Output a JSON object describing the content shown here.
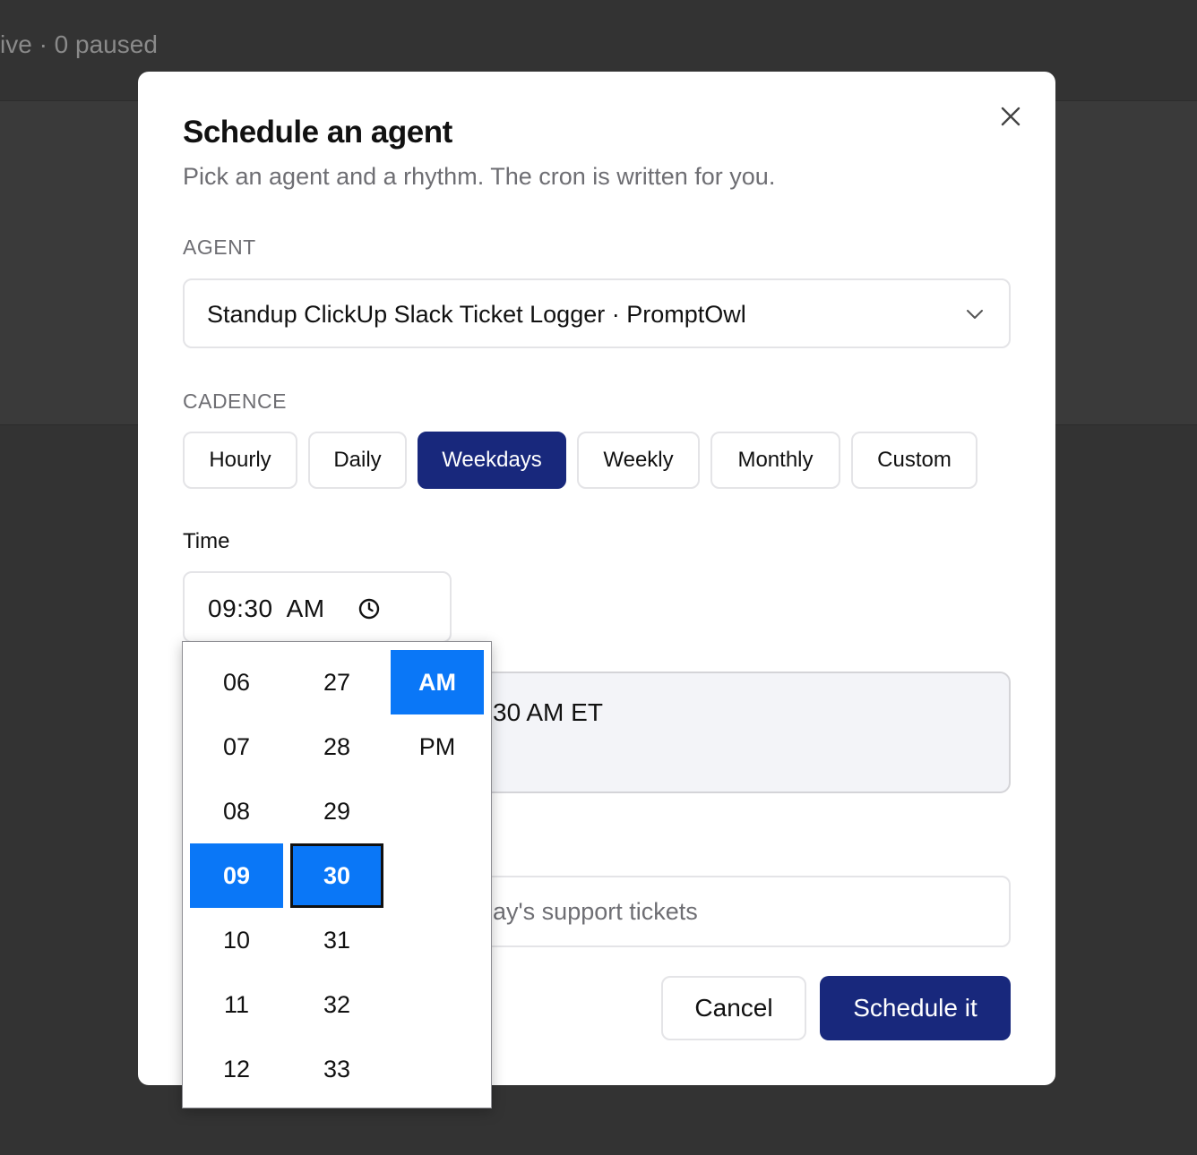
{
  "background": {
    "status_text": "ive · 0 paused"
  },
  "modal": {
    "title": "Schedule an agent",
    "subtitle": "Pick an agent and a rhythm. The cron is written for you.",
    "close_icon": "close-icon",
    "agent": {
      "label": "AGENT",
      "selected": "Standup ClickUp Slack Ticket Logger · PromptOwl",
      "chevron_icon": "chevron-down-icon"
    },
    "cadence": {
      "label": "CADENCE",
      "options": [
        "Hourly",
        "Daily",
        "Weekdays",
        "Weekly",
        "Monthly",
        "Custom"
      ],
      "selected": "Weekdays"
    },
    "time": {
      "label": "Time",
      "value": "09:30  AM",
      "icon": "clock-icon"
    },
    "summary_text": "30 AM ET",
    "name_placeholder": "ay's support tickets",
    "buttons": {
      "cancel": "Cancel",
      "submit": "Schedule it"
    }
  },
  "time_picker": {
    "hours": [
      "06",
      "07",
      "08",
      "09",
      "10",
      "11",
      "12"
    ],
    "minutes": [
      "27",
      "28",
      "29",
      "30",
      "31",
      "32",
      "33"
    ],
    "periods": [
      "AM",
      "PM"
    ],
    "selected_hour": "09",
    "selected_minute": "30",
    "selected_period": "AM"
  },
  "colors": {
    "primary": "#18287c",
    "picker_selection": "#0a77f7",
    "backdrop": "#333333"
  }
}
